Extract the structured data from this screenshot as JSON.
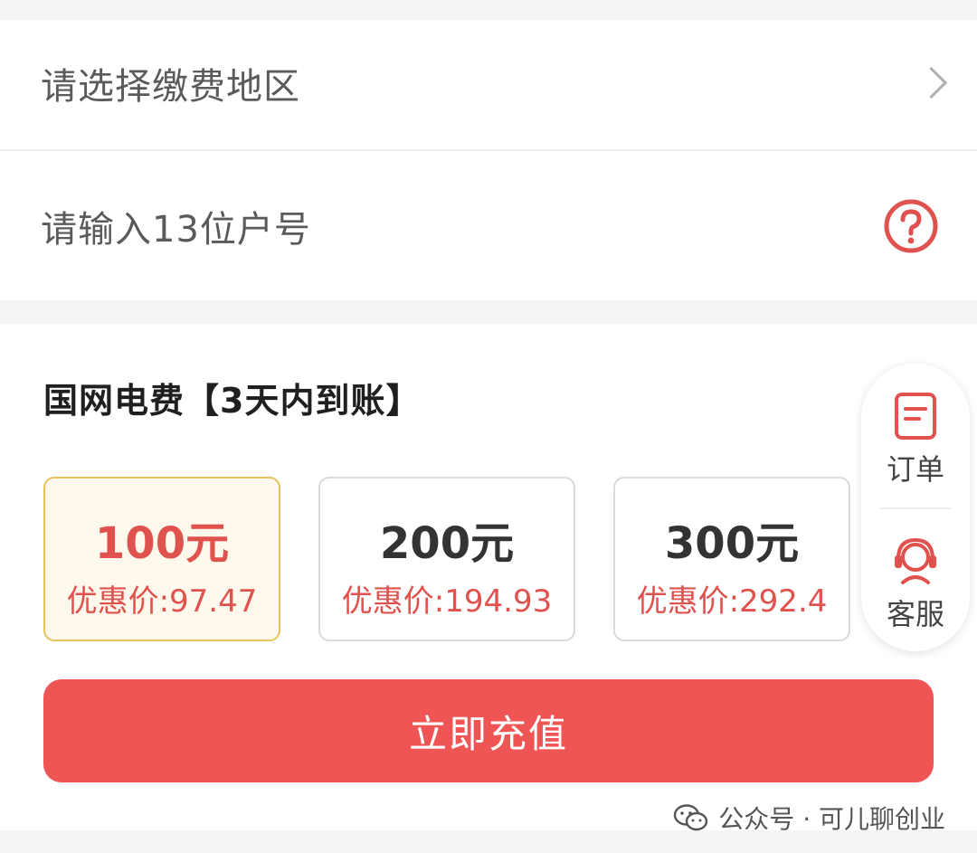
{
  "form": {
    "region_placeholder": "请选择缴费地区",
    "account_placeholder": "请输入13位户号"
  },
  "section": {
    "title": "国网电费【3天内到账】"
  },
  "options": [
    {
      "amount": "100元",
      "price": "优惠价:97.47",
      "selected": true
    },
    {
      "amount": "200元",
      "price": "优惠价:194.93",
      "selected": false
    },
    {
      "amount": "300元",
      "price": "优惠价:292.4",
      "selected": false
    }
  ],
  "actions": {
    "recharge_label": "立即充值"
  },
  "float_menu": {
    "orders_label": "订单",
    "service_label": "客服"
  },
  "watermark": {
    "text": "公众号 · 可儿聊创业"
  },
  "colors": {
    "accent_red": "#f05555",
    "price_red": "#e0524e",
    "selected_border": "#e8c25a",
    "selected_bg": "#fff8ec"
  },
  "icons": {
    "region_row": "chevron-right-icon",
    "account_row": "help-circle-icon",
    "orders": "document-icon",
    "service": "headset-icon",
    "watermark": "wechat-icon"
  }
}
